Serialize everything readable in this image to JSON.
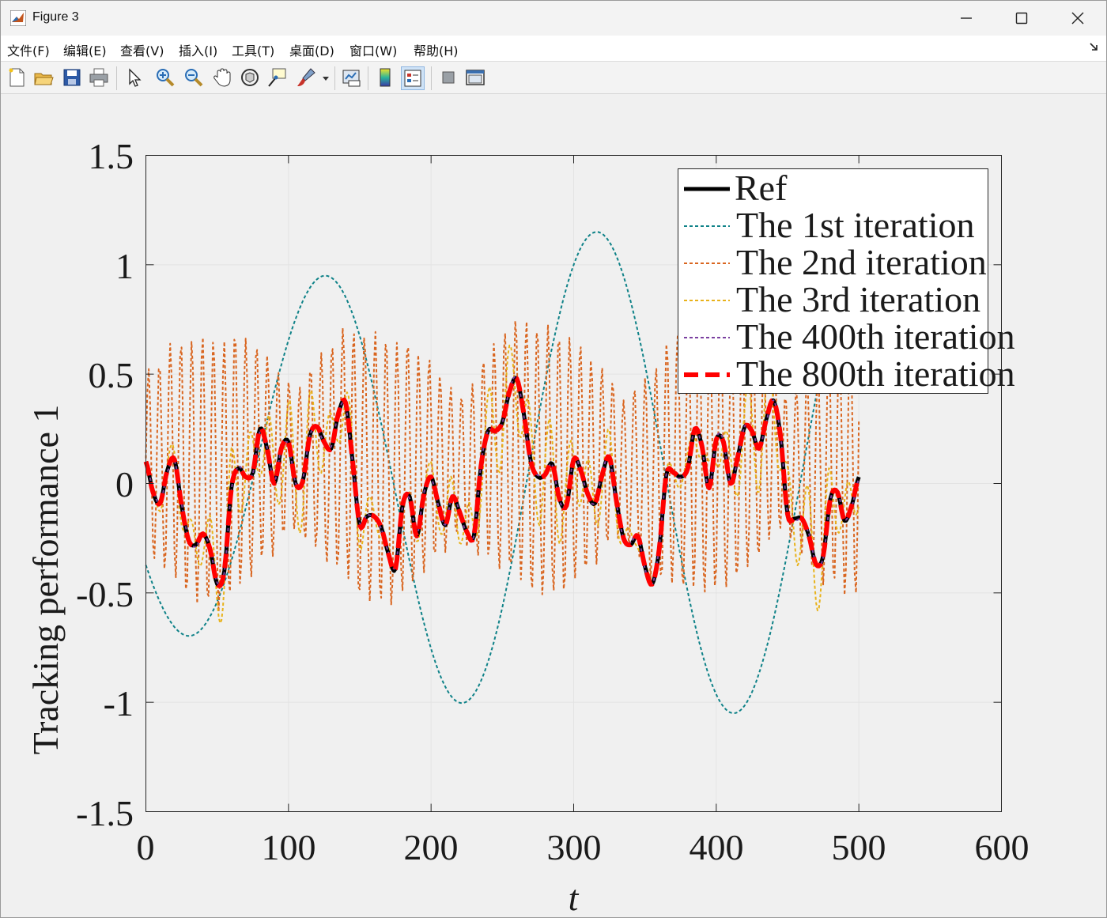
{
  "window": {
    "title": "Figure 3",
    "controls": [
      "minimize",
      "maximize",
      "close"
    ]
  },
  "menu": [
    "文件(F)",
    "编辑(E)",
    "查看(V)",
    "插入(I)",
    "工具(T)",
    "桌面(D)",
    "窗口(W)",
    "帮助(H)"
  ],
  "toolbar": [
    "new-figure-icon",
    "open-file-icon",
    "save-icon",
    "print-icon",
    "edit-plot-arrow-icon",
    "zoom-in-icon",
    "zoom-out-icon",
    "pan-hand-icon",
    "rotate-3d-icon",
    "data-cursor-icon",
    "brush-icon",
    "link-plot-icon",
    "colorbar-icon",
    "legend-icon",
    "hide-plot-tools-icon",
    "show-plot-tools-icon"
  ],
  "chart_data": {
    "type": "line",
    "xlabel": "t",
    "ylabel": "Tracking performance 1",
    "xlim": [
      0,
      600
    ],
    "ylim": [
      -1.5,
      1.5
    ],
    "xticks": [
      "0",
      "100",
      "200",
      "300",
      "400",
      "500",
      "600"
    ],
    "yticks": [
      "1.5",
      "1",
      "0.5",
      "0",
      "-0.5",
      "-1",
      "-1.5"
    ],
    "grid": true,
    "legend_position": "top-right",
    "series": [
      {
        "name": "Ref",
        "color": "#000000",
        "style": "solid",
        "x": [
          0,
          5,
          10,
          15,
          20,
          25,
          30,
          35,
          40,
          45,
          50,
          55,
          60,
          65,
          70,
          75,
          80,
          85,
          90,
          95,
          100,
          105,
          110,
          115,
          120,
          125,
          130,
          135,
          140,
          145,
          150,
          155,
          160,
          165,
          170,
          175,
          180,
          185,
          190,
          195,
          200,
          205,
          210,
          215,
          220,
          225,
          230,
          235,
          240,
          245,
          250,
          255,
          260,
          265,
          270,
          275,
          280,
          285,
          290,
          295,
          300,
          305,
          310,
          315,
          320,
          325,
          330,
          335,
          340,
          345,
          350,
          355,
          360,
          365,
          370,
          375,
          380,
          385,
          390,
          395,
          400,
          405,
          410,
          415,
          420,
          425,
          430,
          435,
          440,
          445,
          450,
          455,
          460,
          465,
          470,
          475,
          480,
          485,
          490,
          495,
          500
        ],
        "y": [
          0.1,
          -0.04,
          -0.09,
          0.06,
          0.11,
          -0.1,
          -0.26,
          -0.28,
          -0.23,
          -0.3,
          -0.46,
          -0.4,
          -0.02,
          0.07,
          0.03,
          0.05,
          0.25,
          0.16,
          0.0,
          0.16,
          0.19,
          0.0,
          0.01,
          0.22,
          0.26,
          0.19,
          0.16,
          0.32,
          0.37,
          0.1,
          -0.19,
          -0.15,
          -0.15,
          -0.2,
          -0.32,
          -0.39,
          -0.1,
          -0.06,
          -0.24,
          -0.05,
          0.03,
          -0.09,
          -0.19,
          -0.06,
          -0.13,
          -0.22,
          -0.24,
          0.08,
          0.24,
          0.24,
          0.28,
          0.42,
          0.48,
          0.32,
          0.1,
          0.03,
          0.04,
          0.09,
          -0.07,
          -0.1,
          0.11,
          0.06,
          -0.05,
          -0.09,
          0.04,
          0.12,
          -0.08,
          -0.25,
          -0.28,
          -0.24,
          -0.38,
          -0.46,
          -0.3,
          0.04,
          0.05,
          0.03,
          0.07,
          0.25,
          0.17,
          -0.02,
          0.2,
          0.19,
          0.0,
          0.12,
          0.26,
          0.24,
          0.16,
          0.29,
          0.38,
          0.22,
          -0.14,
          -0.16,
          -0.16,
          -0.24,
          -0.37,
          -0.33,
          -0.07,
          -0.04,
          -0.17,
          -0.1,
          0.03
        ]
      },
      {
        "name": "The 1st iteration",
        "color": "#0f8288",
        "style": "dotted"
      },
      {
        "name": "The 2nd iteration",
        "color": "#d9651f",
        "style": "dotted"
      },
      {
        "name": "The 3rd iteration",
        "color": "#e8b21a",
        "style": "dotted"
      },
      {
        "name": "The 400th iteration",
        "color": "#7a3fa0",
        "style": "dotted"
      },
      {
        "name": "The 800th iteration",
        "color": "#ff0000",
        "style": "dashed"
      }
    ]
  }
}
